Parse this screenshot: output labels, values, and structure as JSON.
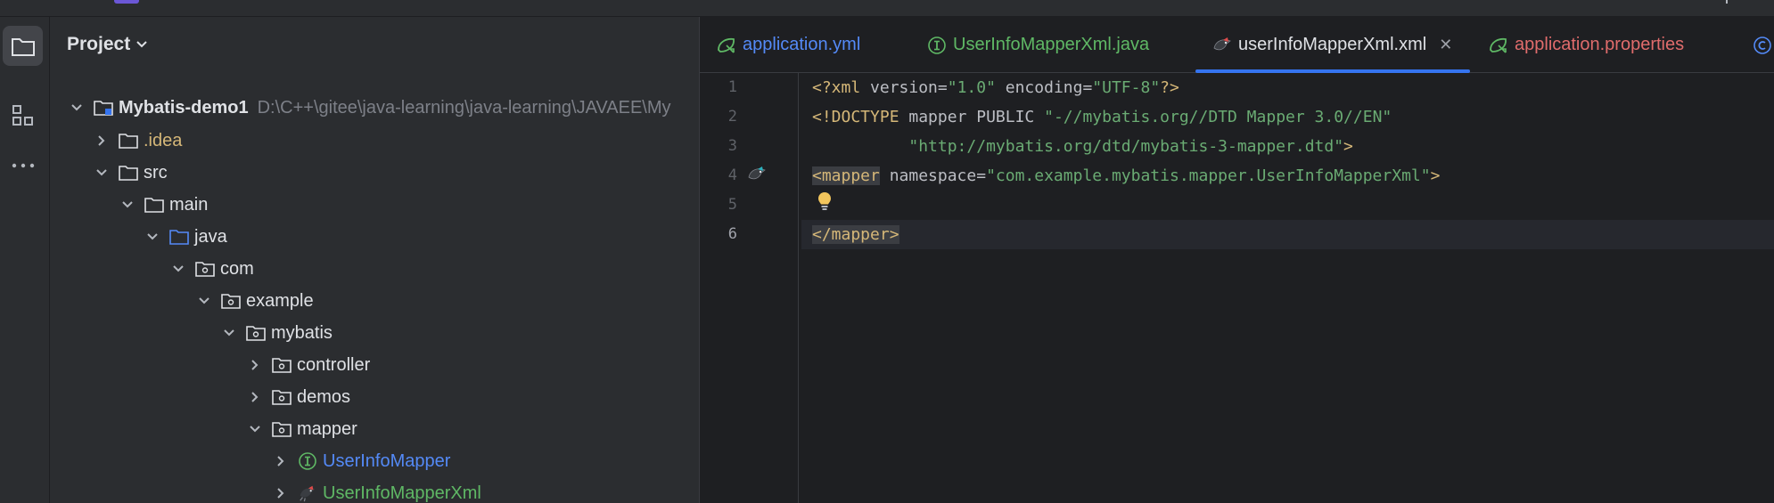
{
  "project_panel": {
    "title": "Project",
    "tree": [
      {
        "label": "Mybatis-demo1",
        "path": "D:\\C++\\gitee\\java-learning\\java-learning\\JAVAEE\\My",
        "color": "#dfe1e5"
      },
      {
        "label": ".idea",
        "color": "#d5b778"
      },
      {
        "label": "src",
        "color": "#dfe1e5"
      },
      {
        "label": "main",
        "color": "#dfe1e5"
      },
      {
        "label": "java",
        "color": "#dfe1e5"
      },
      {
        "label": "com",
        "color": "#dfe1e5"
      },
      {
        "label": "example",
        "color": "#dfe1e5"
      },
      {
        "label": "mybatis",
        "color": "#dfe1e5"
      },
      {
        "label": "controller",
        "color": "#dfe1e5"
      },
      {
        "label": "demos",
        "color": "#dfe1e5"
      },
      {
        "label": "mapper",
        "color": "#dfe1e5"
      },
      {
        "label": "UserInfoMapper",
        "color": "#548af7"
      },
      {
        "label": "UserInfoMapperXml",
        "color": "#5fb865"
      }
    ]
  },
  "editor": {
    "tabs": [
      {
        "label": "application.yml",
        "icon": "spring-config-icon",
        "color": "#548af7"
      },
      {
        "label": "UserInfoMapperXml.java",
        "icon": "interface-icon",
        "color": "#5fb865"
      },
      {
        "label": "userInfoMapperXml.xml",
        "icon": "mybatis-bird-icon",
        "color": "#dfe1e5",
        "active": true
      },
      {
        "label": "application.properties",
        "icon": "spring-config-icon",
        "color": "#e06c6c"
      }
    ],
    "line_numbers": [
      "1",
      "2",
      "3",
      "4",
      "5",
      "6"
    ],
    "code": {
      "l1_open": "<?xml",
      "l1_attr1": " version=",
      "l1_val1": "\"1.0\"",
      "l1_attr2": " encoding=",
      "l1_val2": "\"UTF-8\"",
      "l1_close": "?>",
      "l2_doctype": "<!DOCTYPE",
      "l2_rest": " mapper PUBLIC ",
      "l2_str": "\"-//mybatis.org//DTD Mapper 3.0//EN\"",
      "l3_indent": "          ",
      "l3_str": "\"http://mybatis.org/dtd/mybatis-3-mapper.dtd\"",
      "l3_close": ">",
      "l4_tag": "<mapper",
      "l4_attr": " namespace=",
      "l4_str": "\"com.example.mybatis.mapper.UserInfoMapperXml\"",
      "l4_close": ">",
      "l6_tag": "</mapper>"
    }
  },
  "colors": {
    "accent": "#3574f0",
    "bulb": "#f2c55c"
  }
}
